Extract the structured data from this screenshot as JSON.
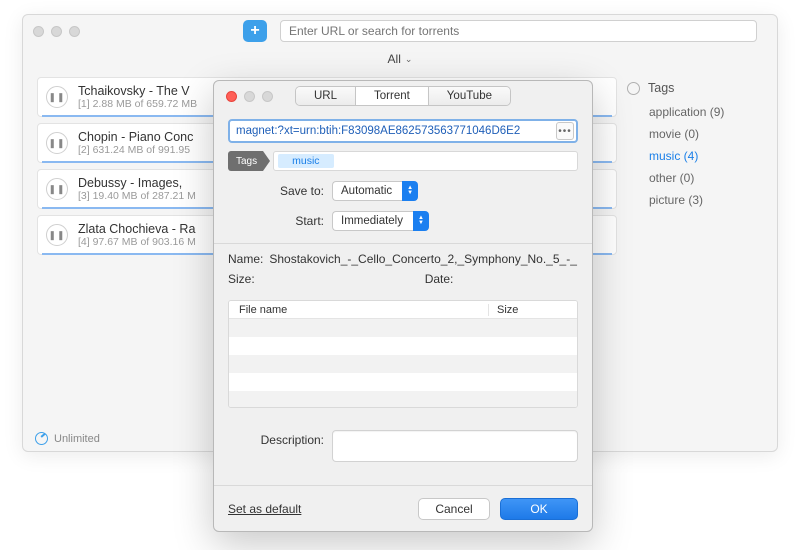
{
  "header": {
    "search_placeholder": "Enter URL or search for torrents",
    "plus": "+"
  },
  "filter": {
    "label": "All"
  },
  "downloads": [
    {
      "title": "Tchaikovsky - The V",
      "sub": "[1] 2.88 MB of 659.72 MB"
    },
    {
      "title": "Chopin - Piano Conc",
      "sub": "[2] 631.24 MB of 991.95"
    },
    {
      "title": "Debussy  - Images, ",
      "sub": "[3] 19.40 MB of 287.21 M"
    },
    {
      "title": "Zlata Chochieva - Ra",
      "sub": "[4] 97.67 MB of 903.16 M"
    }
  ],
  "sidebar": {
    "header": "Tags",
    "items": [
      {
        "label": "application (9)",
        "selected": false
      },
      {
        "label": "movie (0)",
        "selected": false
      },
      {
        "label": "music (4)",
        "selected": true
      },
      {
        "label": "other (0)",
        "selected": false
      },
      {
        "label": "picture (3)",
        "selected": false
      }
    ]
  },
  "footer": {
    "unlimited": "Unlimited"
  },
  "dialog": {
    "tabs": {
      "url": "URL",
      "torrent": "Torrent",
      "youtube": "YouTube"
    },
    "url_value": "magnet:?xt=urn:btih:F83098AE862573563771046D6E2",
    "tags_label": "Tags",
    "tag_chip": "music",
    "save_to_label": "Save to:",
    "save_to_value": "Automatic",
    "start_label": "Start:",
    "start_value": "Immediately",
    "name_label": "Name:",
    "name_value": "Shostakovich_-_Cello_Concerto_2,_Symphony_No._5_-_",
    "size_label": "Size:",
    "date_label": "Date:",
    "table": {
      "filename_header": "File name",
      "size_header": "Size"
    },
    "description_label": "Description:",
    "set_as_default": "Set as default",
    "cancel": "Cancel",
    "ok": "OK",
    "more_glyph": "•••"
  }
}
